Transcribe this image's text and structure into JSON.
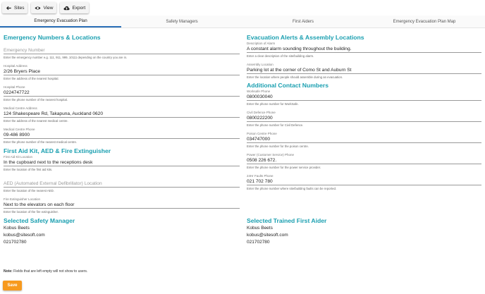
{
  "toolbar": {
    "sites_label": "Sites",
    "view_label": "View",
    "export_label": "Export"
  },
  "tabs": [
    {
      "label": "Emergency Evacuation Plan",
      "active": true
    },
    {
      "label": "Safety Managers",
      "active": false
    },
    {
      "label": "First Aiders",
      "active": false
    },
    {
      "label": "Emergency Evacuation Plan Map",
      "active": false
    }
  ],
  "emergency": {
    "title": "Emergency Numbers & Locations",
    "emergency_number": {
      "placeholder": "Emergency Number",
      "help": "Enter the emergency number e.g. 111, 911, 999, 10111 depending on the country you are in."
    },
    "hospital_address": {
      "label": "Hospital Address",
      "value": "2/26 Bryers Place",
      "help": "Enter the address of the nearest hospital."
    },
    "hospital_phone": {
      "label": "Hospital Phone",
      "value": "0224747722",
      "help": "Enter the phone number of the nearest hospital."
    },
    "medical_address": {
      "label": "Medical Centre Address",
      "value": "124 Shakespeare Rd, Takapuna, Auckland 0620",
      "help": "Enter the address of the nearest medical centre."
    },
    "medical_phone": {
      "label": "Medical Centre Phone",
      "value": "09-486 8900",
      "help": "Enter the phone number of the nearest medical centre."
    }
  },
  "firstaid": {
    "title": "First Aid Kit, AED & Fire Extinguisher",
    "kit_location": {
      "label": "First Aid Kit Location",
      "value": "In the cupboard next to the receptions desk",
      "help": "Enter the location of the first aid kits."
    },
    "aed_location": {
      "placeholder": "AED (Automated External Defibrillator) Location",
      "help": "Enter the location of the nearest AED."
    },
    "extinguisher_location": {
      "label": "Fire Extinguisher Location",
      "value": "Next to the elevators on each floor",
      "help": "Enter the location of the fire extinguisher."
    }
  },
  "safety_manager": {
    "title": "Selected Safety Manager",
    "name": "Kobus Beets",
    "email": "kobus@sitesoft.com",
    "phone": "021702780"
  },
  "evacuation": {
    "title": "Evacuation Alerts & Assembly Locations",
    "alarm": {
      "label": "Description of Alarm",
      "value": "A constant alarm sounding throughout the building.",
      "help": "Enter a clear description of the site/building alarm."
    },
    "assembly": {
      "label": "Assembly Location",
      "value": "Parking lot at the corner of Como St and Auburn St",
      "help": "Enter the location where people should assemble during an evacuation."
    }
  },
  "contacts": {
    "title": "Additional Contact Numbers",
    "worksafe": {
      "label": "Worksafe Phone",
      "value": "0800030040",
      "help": "Enter the phone number for WorkSafe."
    },
    "civil": {
      "label": "Civil Defence Phone",
      "value": "0800222200",
      "help": "Enter the phone number for Civil Defence."
    },
    "poison": {
      "label": "Poison Centre Phone",
      "value": "034747000",
      "help": "Enter the phone number for the poison centre."
    },
    "power": {
      "label": "Power (Customer Service) Phone",
      "value": "0508 226 672.",
      "help": "Enter the phone number for the power service provider."
    },
    "faults": {
      "label": "24Hr Faults Phone",
      "value": "021 702 780",
      "help": "Enter the phone number where site/building faults can be reported."
    }
  },
  "first_aider": {
    "title": "Selected Trained First Aider",
    "name": "Kobus Beets",
    "email": "kobus@sitesoft.com",
    "phone": "021702780"
  },
  "note": {
    "label": "Note:",
    "text": " Fields that are left empty will not show to users."
  },
  "save_label": "Save"
}
